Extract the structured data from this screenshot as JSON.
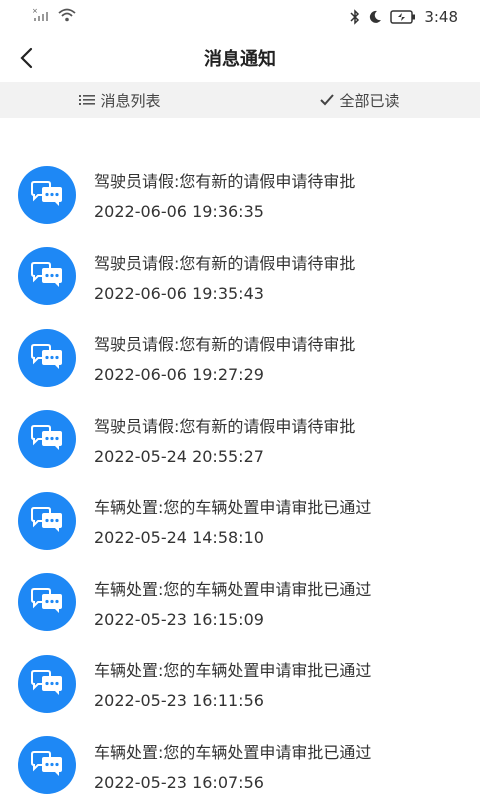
{
  "status_bar": {
    "signal_text": "×",
    "time": "3:48"
  },
  "header": {
    "title": "消息通知"
  },
  "toolbar": {
    "list_label": "消息列表",
    "read_all_label": "全部已读"
  },
  "messages": [
    {
      "title": "驾驶员请假:您有新的请假申请待审批",
      "time": "2022-06-06 19:36:35"
    },
    {
      "title": "驾驶员请假:您有新的请假申请待审批",
      "time": "2022-06-06 19:35:43"
    },
    {
      "title": "驾驶员请假:您有新的请假申请待审批",
      "time": "2022-06-06 19:27:29"
    },
    {
      "title": "驾驶员请假:您有新的请假申请待审批",
      "time": "2022-05-24 20:55:27"
    },
    {
      "title": "车辆处置:您的车辆处置申请审批已通过",
      "time": "2022-05-24 14:58:10"
    },
    {
      "title": "车辆处置:您的车辆处置申请审批已通过",
      "time": "2022-05-23 16:15:09"
    },
    {
      "title": "车辆处置:您的车辆处置申请审批已通过",
      "time": "2022-05-23 16:11:56"
    },
    {
      "title": "车辆处置:您的车辆处置申请审批已通过",
      "time": "2022-05-23 16:07:56"
    }
  ],
  "colors": {
    "accent": "#1e88f5",
    "toolbar_bg": "#f2f2f2"
  }
}
